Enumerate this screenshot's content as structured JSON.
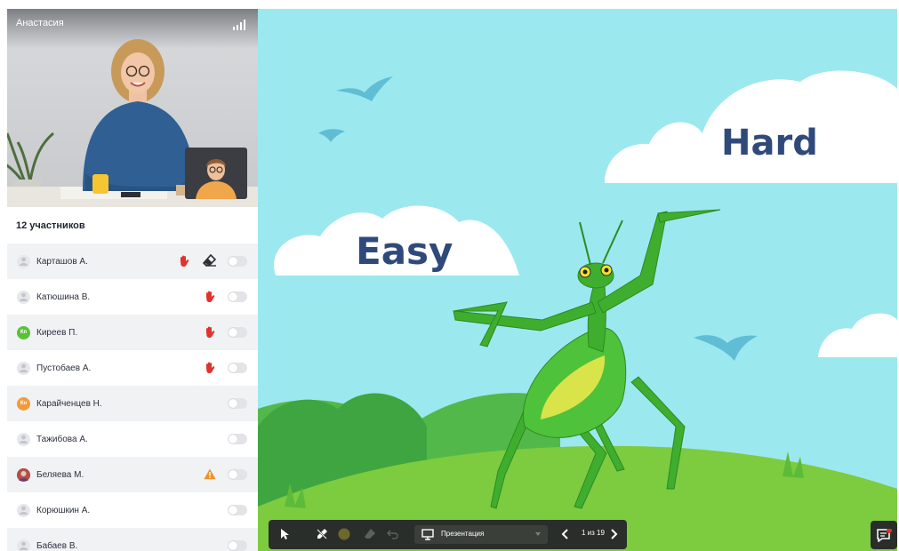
{
  "speaker": {
    "name": "Анастасия",
    "signal_icon": "signal-bars-icon"
  },
  "participants": {
    "count_label": "12 участников",
    "items": [
      {
        "name": "Карташов А.",
        "avatar": "",
        "avatar_color": "#e6e7ea",
        "hand": true,
        "eraser": true,
        "warning": false
      },
      {
        "name": "Катюшина В.",
        "avatar": "",
        "avatar_color": "#e6e7ea",
        "hand": true,
        "eraser": false,
        "warning": false
      },
      {
        "name": "Киреев П.",
        "avatar": "Кп",
        "avatar_color": "#57c234",
        "hand": true,
        "eraser": false,
        "warning": false
      },
      {
        "name": "Пустобаев А.",
        "avatar": "",
        "avatar_color": "#e6e7ea",
        "hand": true,
        "eraser": false,
        "warning": false
      },
      {
        "name": "Карайченцев Н.",
        "avatar": "Кн",
        "avatar_color": "#f29a3c",
        "hand": false,
        "eraser": false,
        "warning": false
      },
      {
        "name": "Тажибова А.",
        "avatar": "",
        "avatar_color": "#e6e7ea",
        "hand": false,
        "eraser": false,
        "warning": false
      },
      {
        "name": "Беляева М.",
        "avatar": "photo",
        "avatar_color": "#b0504a",
        "hand": false,
        "eraser": false,
        "warning": true
      },
      {
        "name": "Корюшкин А.",
        "avatar": "",
        "avatar_color": "#e6e7ea",
        "hand": false,
        "eraser": false,
        "warning": false
      },
      {
        "name": "Бабаев В.",
        "avatar": "",
        "avatar_color": "#e6e7ea",
        "hand": false,
        "eraser": false,
        "warning": false
      }
    ]
  },
  "slide": {
    "word_easy": "Easy",
    "word_hard": "Hard"
  },
  "toolbar": {
    "presentation_label": "Презентация",
    "page_indicator": "1 из 19",
    "color_dot": "#6b6a2a"
  },
  "colors": {
    "hand": "#e0332d",
    "warning": "#f0912a",
    "accent_green": "#57c234"
  }
}
